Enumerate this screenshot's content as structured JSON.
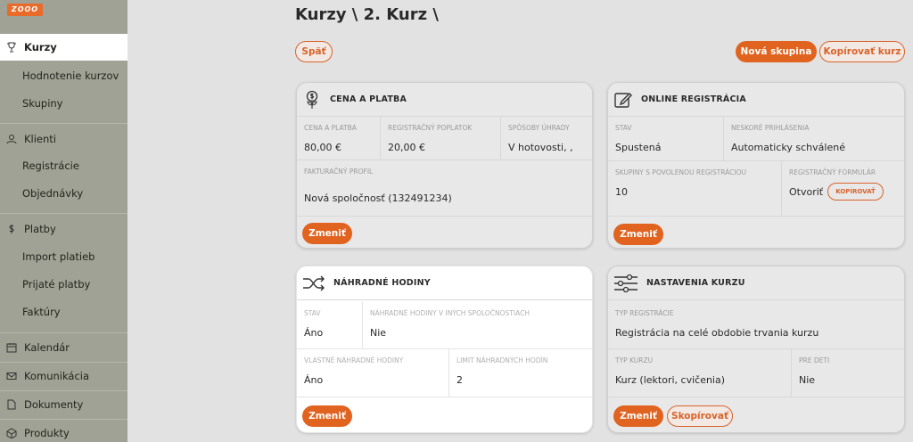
{
  "logo_text": "ZOOO",
  "sidebar": {
    "items": [
      {
        "label": "Kurzy",
        "icon": "trophy-icon"
      },
      {
        "label": "Hodnotenie kurzov"
      },
      {
        "label": "Skupiny"
      },
      {
        "label": "Klienti",
        "icon": "users-icon"
      },
      {
        "label": "Registrácie"
      },
      {
        "label": "Objednávky"
      },
      {
        "label": "Platby",
        "icon": "dollar-icon"
      },
      {
        "label": "Import platieb"
      },
      {
        "label": "Prijaté platby"
      },
      {
        "label": "Faktúry"
      },
      {
        "label": "Kalendár",
        "icon": "calendar-icon"
      },
      {
        "label": "Komunikácia",
        "icon": "mail-icon"
      },
      {
        "label": "Dokumenty",
        "icon": "document-icon"
      },
      {
        "label": "Produkty",
        "icon": "box-icon"
      }
    ]
  },
  "header": {
    "title": "Kurzy \\ 2. Kurz \\"
  },
  "toolbar": {
    "back": "Späť",
    "new_group": "Nová skupina",
    "copy_course": "Kopírovať kurz"
  },
  "colors": {
    "accent": "#e0631f"
  },
  "price_card": {
    "title": "CENA A PLATBA",
    "price_label": "CENA A PLATBA",
    "price_value": "80,00 €",
    "fee_label": "REGISTRAČNÝ POPLATOK",
    "fee_value": "20,00 €",
    "method_label": "SPÔSOBY ÚHRADY",
    "method_value": "V hotovosti, ,",
    "invoice_label": "FAKTURAČNÝ PROFIL",
    "invoice_value": "Nová spoločnosť (132491234)",
    "change": "Zmeniť"
  },
  "online_card": {
    "title": "ONLINE REGISTRÁCIA",
    "state_label": "STAV",
    "state_value": "Spustená",
    "late_label": "NESKORÉ PRIHLÁSENIA",
    "late_value": "Automaticky schválené",
    "groups_label": "SKUPINY S POVOLENOU REGISTRÁCIOU",
    "groups_value": "10",
    "form_label": "REGISTRAČNÝ FORMULÁR",
    "form_open": "Otvoriť",
    "form_copy": "KOPÍROVAŤ",
    "change": "Zmeniť"
  },
  "makeup_card": {
    "title": "NÁHRADNÉ HODINY",
    "state_label": "STAV",
    "state_value": "Áno",
    "other_label": "NÁHRADNÉ HODINY V INÝCH SPOLOČNOSTIACH",
    "other_value": "Nie",
    "own_label": "VLASTNÉ NÁHRADNÉ HODINY",
    "own_value": "Áno",
    "limit_label": "LIMIT NÁHRADNÝCH HODÍN",
    "limit_value": "2",
    "change": "Zmeniť"
  },
  "settings_card": {
    "title": "NASTAVENIA KURZU",
    "reg_type_label": "TYP REGISTRÁCIE",
    "reg_type_value": "Registrácia na celé obdobie trvania kurzu",
    "course_type_label": "TYP KURZU",
    "course_type_value": "Kurz (lektori, cvičenia)",
    "kids_label": "PRE DETI",
    "kids_value": "Nie",
    "change": "Zmeniť",
    "copy": "Skopírovať"
  }
}
